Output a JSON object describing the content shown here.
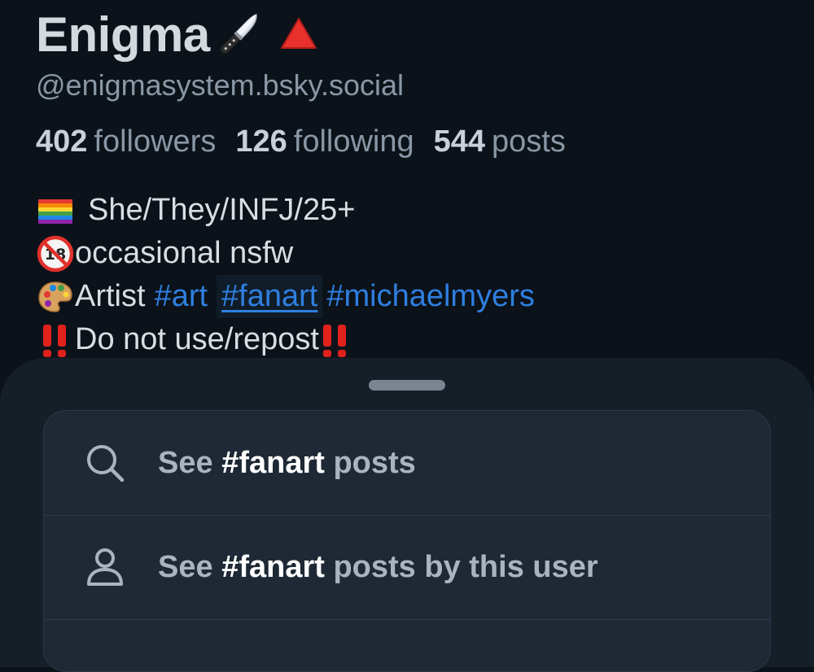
{
  "profile": {
    "display_name": "Enigma",
    "name_emojis": [
      "kitchen-knife-emoji",
      "red-triangle-emoji"
    ],
    "handle": "@enigmasystem.bsky.social",
    "stats": {
      "followers_count": "402",
      "followers_label": "followers",
      "following_count": "126",
      "following_label": "following",
      "posts_count": "544",
      "posts_label": "posts"
    },
    "bio": {
      "line1": "She/They/INFJ/25+",
      "line2": "occasional nsfw",
      "line3_prefix": "Artist",
      "hashtags": [
        "#art",
        "#fanart",
        "#michaelmyers"
      ],
      "line4": "Do not use/repost"
    }
  },
  "sheet": {
    "items": [
      {
        "icon": "search-icon",
        "prefix": "See",
        "tag": "#fanart",
        "suffix": "posts"
      },
      {
        "icon": "person-icon",
        "prefix": "See",
        "tag": "#fanart",
        "suffix": "posts by this user"
      }
    ]
  },
  "colors": {
    "background": "#0b1219",
    "sheet": "#161e27",
    "menu": "#1e2935",
    "hashtag": "#2f7fe0"
  }
}
